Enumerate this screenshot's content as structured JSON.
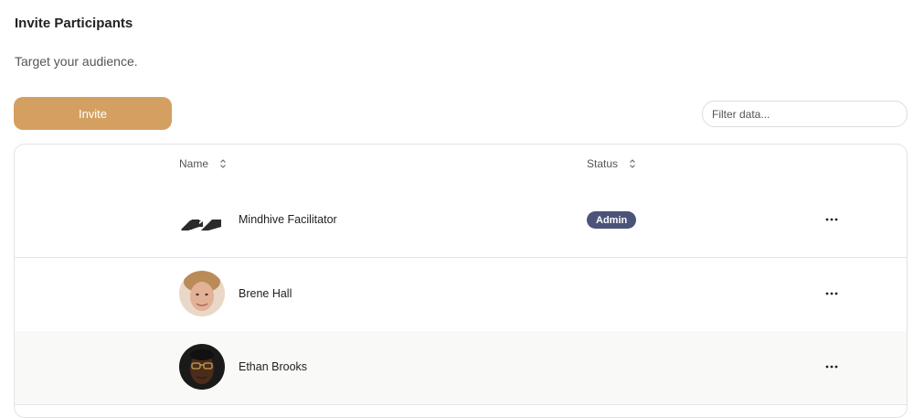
{
  "header": {
    "title": "Invite Participants",
    "subtitle": "Target your audience."
  },
  "toolbar": {
    "invite_label": "Invite",
    "filter_placeholder": "Filter data..."
  },
  "table": {
    "columns": [
      "Name",
      "Status"
    ],
    "rows": [
      {
        "name": "Mindhive Facilitator",
        "status": "Admin",
        "avatar": "mindhive-logo-icon"
      },
      {
        "name": "Brene Hall",
        "status": "",
        "avatar": "person-photo"
      },
      {
        "name": "Ethan Brooks",
        "status": "",
        "avatar": "person-photo"
      }
    ]
  },
  "colors": {
    "invite_button": "#d4a062",
    "admin_badge": "#4b5478"
  }
}
